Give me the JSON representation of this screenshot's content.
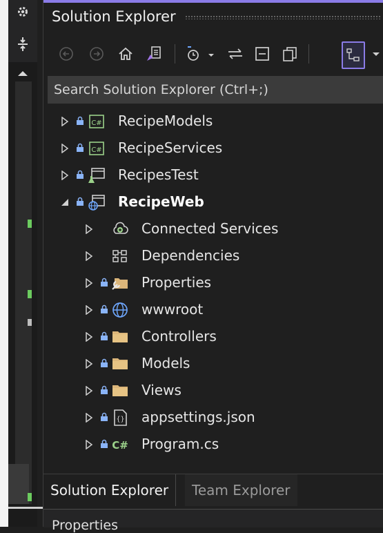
{
  "panel": {
    "title": "Solution Explorer"
  },
  "search": {
    "placeholder": "Search Solution Explorer (Ctrl+;)"
  },
  "toolbar": {
    "buttons": [
      {
        "icon": "back-icon",
        "enabled": false
      },
      {
        "icon": "forward-icon",
        "enabled": false
      },
      {
        "icon": "home-icon",
        "enabled": true
      },
      {
        "icon": "switch-views-icon",
        "enabled": true
      },
      {
        "icon": "pending-changes-filter-icon",
        "enabled": true
      },
      {
        "icon": "sync-with-active-document-icon",
        "enabled": true
      },
      {
        "icon": "collapse-all-icon",
        "enabled": true
      },
      {
        "icon": "show-all-files-icon",
        "enabled": true
      },
      {
        "icon": "preview-selected-items-icon",
        "enabled": true,
        "active": true
      }
    ]
  },
  "tree": {
    "items": [
      {
        "label": "RecipeModels",
        "icon": "csharp-project-icon",
        "level": 0,
        "expanded": false,
        "locked": true
      },
      {
        "label": "RecipeServices",
        "icon": "csharp-project-icon",
        "level": 0,
        "expanded": false,
        "locked": true
      },
      {
        "label": "RecipesTest",
        "icon": "test-project-icon",
        "level": 0,
        "expanded": false,
        "locked": true
      },
      {
        "label": "RecipeWeb",
        "icon": "web-project-icon",
        "level": 0,
        "expanded": true,
        "locked": true,
        "bold": true
      },
      {
        "label": "Connected Services",
        "icon": "connected-services-icon",
        "level": 1,
        "expanded": false,
        "locked": false
      },
      {
        "label": "Dependencies",
        "icon": "dependencies-icon",
        "level": 1,
        "expanded": false,
        "locked": false
      },
      {
        "label": "Properties",
        "icon": "properties-folder-icon",
        "level": 1,
        "expanded": false,
        "locked": true
      },
      {
        "label": "wwwroot",
        "icon": "globe-icon",
        "level": 1,
        "expanded": false,
        "locked": true
      },
      {
        "label": "Controllers",
        "icon": "folder-icon",
        "level": 1,
        "expanded": false,
        "locked": true
      },
      {
        "label": "Models",
        "icon": "folder-icon",
        "level": 1,
        "expanded": false,
        "locked": true
      },
      {
        "label": "Views",
        "icon": "folder-icon",
        "level": 1,
        "expanded": false,
        "locked": true
      },
      {
        "label": "appsettings.json",
        "icon": "json-file-icon",
        "level": 1,
        "expanded": false,
        "locked": true
      },
      {
        "label": "Program.cs",
        "icon": "csharp-file-icon",
        "level": 1,
        "expanded": false,
        "locked": true
      }
    ]
  },
  "tabs": [
    {
      "label": "Solution Explorer",
      "active": true
    },
    {
      "label": "Team Explorer",
      "active": false
    }
  ],
  "properties_panel": {
    "title": "Properties"
  },
  "colors": {
    "accent": "#8b7ce8",
    "background": "#1f1f1f",
    "search_bg": "#3b3b3b",
    "folder": "#dcb67a",
    "lock": "#8ab4f8",
    "csharp": "#9bd18a",
    "globe": "#6fa8ff",
    "change_marker": "#6ccb5f"
  }
}
